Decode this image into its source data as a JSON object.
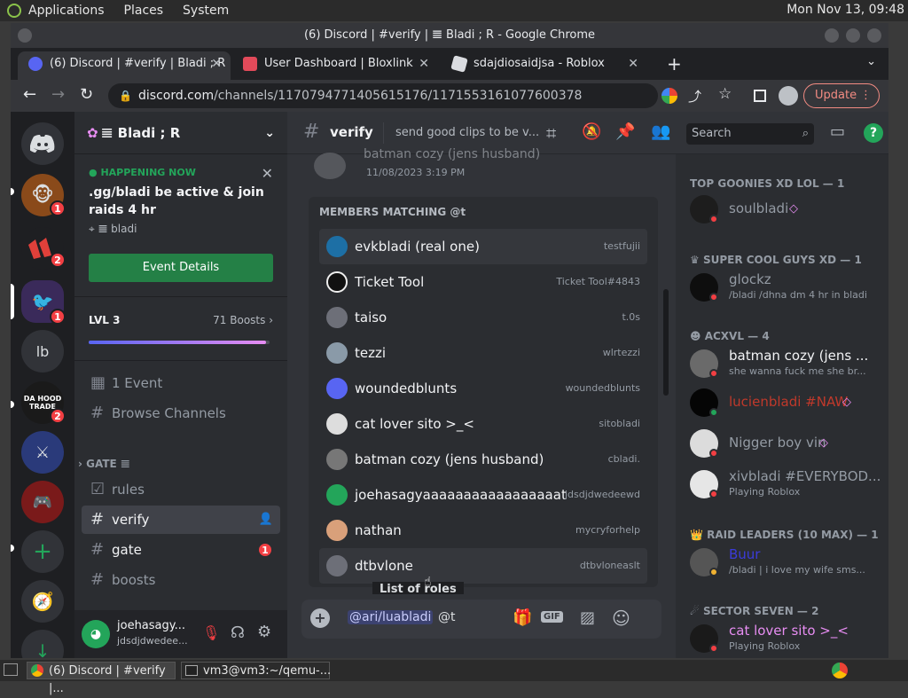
{
  "os": {
    "menu": [
      "Applications",
      "Places",
      "System"
    ],
    "clock": "Mon Nov 13, 09:48"
  },
  "browser": {
    "window_title": "(6) Discord | #verify | 𝌆 Bladi ; R - Google Chrome",
    "tabs": [
      {
        "label": "(6) Discord | #verify |   Bladi ; R",
        "active": true
      },
      {
        "label": "User Dashboard | Bloxlink",
        "active": false
      },
      {
        "label": "sdajdiosaidjsa - Roblox",
        "active": false
      }
    ],
    "url_domain": "discord.com",
    "url_path": "/channels/1170794771405615176/1171553161077600378",
    "update_label": "Update"
  },
  "servers": [
    {
      "name": "server-1",
      "badge": "1"
    },
    {
      "name": "server-2",
      "badge": "2"
    },
    {
      "name": "server-3",
      "badge": "1"
    },
    {
      "name": "lb",
      "label": "lb"
    },
    {
      "name": "da-hood",
      "label": "DA HOOD TRADE",
      "badge": "2"
    },
    {
      "name": "server-6"
    },
    {
      "name": "server-7"
    }
  ],
  "guild": {
    "name": "𝌆 Bladi ; R"
  },
  "event": {
    "status": "HAPPENING NOW",
    "title": ".gg/bladi be active & join raids 4 hr",
    "location": "𝌆 bladi",
    "button": "Event Details"
  },
  "level": {
    "label": "LVL 3",
    "boosts": "71 Boosts",
    "progress": 0.98
  },
  "channels": {
    "events": "1 Event",
    "browse": "Browse Channels",
    "category": "GATE 𝌆",
    "list": [
      {
        "name": "rules",
        "icon": "rules-icon"
      },
      {
        "name": "verify",
        "icon": "hash-icon",
        "selected": true
      },
      {
        "name": "gate",
        "icon": "hash-icon",
        "badge": "1"
      },
      {
        "name": "boosts",
        "icon": "hash-icon"
      }
    ]
  },
  "user": {
    "name": "joehasagy...",
    "tag": "jdsdjdwedee..."
  },
  "channel_header": {
    "name": "verify",
    "topic": "send good clips to be v...",
    "search_placeholder": "Search"
  },
  "message_preview": {
    "author": "batman cozy (jens husband)",
    "timestamp": "11/08/2023 3:19 PM"
  },
  "autocomplete": {
    "heading": "MEMBERS MATCHING @t",
    "members": [
      {
        "name": "evkbladi (real one)",
        "tag": "testfujii",
        "highlight": true
      },
      {
        "name": "Ticket Tool",
        "tag": "Ticket Tool#4843"
      },
      {
        "name": "taiso",
        "tag": "t.0s"
      },
      {
        "name": "tezzi",
        "tag": "wlrtezzi"
      },
      {
        "name": "woundedblunts",
        "tag": "woundedblunts"
      },
      {
        "name": "cat lover sito >_<",
        "tag": "sitobladi"
      },
      {
        "name": "batman cozy (jens husband)",
        "tag": "cbladi."
      },
      {
        "name": "joehasagyaaaaaaaaaaaaaaaaat",
        "tag": "jdsdjdwedeewd"
      },
      {
        "name": "nathan",
        "tag": "mycryforhelp"
      },
      {
        "name": "dtbvlone",
        "tag": "dtbvloneaslt"
      }
    ],
    "footer_hint": "List of roles"
  },
  "composer": {
    "mention": "@ari/luabladi",
    "typed": "@t"
  },
  "member_list": {
    "groups": [
      {
        "title": "TOP GOONIES XD LOL — 1",
        "members": [
          {
            "name": "soulbladi",
            "status": ""
          }
        ]
      },
      {
        "title": "SUPER COOL GUYS XD — 1",
        "members": [
          {
            "name": "glockz",
            "status": "/bladi /dhna dm 4 hr in bladi"
          }
        ]
      },
      {
        "title": "ACXVL — 4",
        "members": [
          {
            "name": "batman cozy (jens ...",
            "status": "she wanna fuck me she br..."
          },
          {
            "name": "lucienbladi #NAW",
            "status": ""
          },
          {
            "name": "Nigger boy vin",
            "status": ""
          },
          {
            "name": "xivbladi #EVERYBOD...",
            "status": "Playing Roblox"
          }
        ]
      },
      {
        "title": "RAID LEADERS (10 MAX) — 1",
        "members": [
          {
            "name": "Buur",
            "status": "/bladi | i love my wife sms..."
          }
        ]
      },
      {
        "title": "SECTOR SEVEN — 2",
        "members": [
          {
            "name": "cat lover sito >_<",
            "status": "Playing Roblox"
          }
        ]
      }
    ]
  },
  "taskbar": {
    "items": [
      "(6) Discord | #verify |...",
      "vm3@vm3:~/qemu-..."
    ]
  },
  "colors": {
    "blurple": "#5865f2",
    "green": "#248046",
    "red": "#f23f43",
    "bg": "#313338"
  }
}
